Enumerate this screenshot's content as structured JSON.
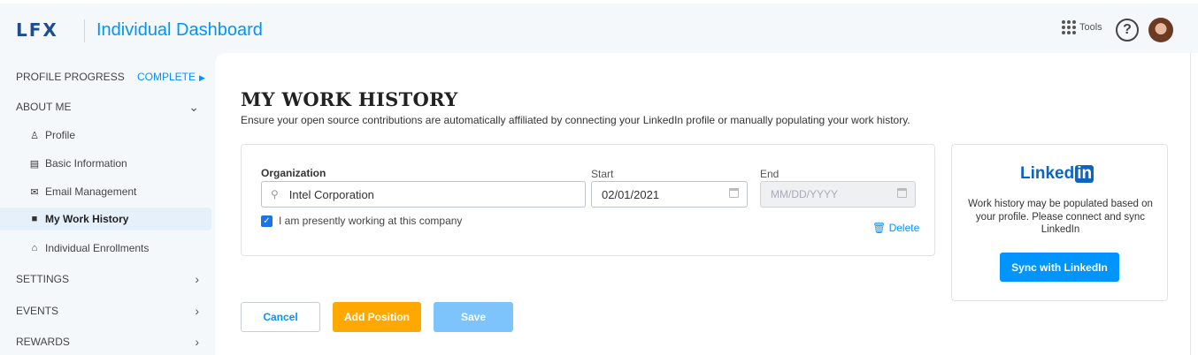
{
  "header": {
    "logo": "LFX",
    "title": "Individual Dashboard",
    "tools_label": "Tools",
    "help_icon": "?"
  },
  "sidebar": {
    "profile_progress": {
      "label": "PROFILE PROGRESS",
      "status": "Complete"
    },
    "about_me": "ABOUT ME",
    "items": [
      {
        "label": "Profile",
        "icon": "person-icon"
      },
      {
        "label": "Basic Information",
        "icon": "id-card-icon"
      },
      {
        "label": "Email Management",
        "icon": "envelope-icon"
      },
      {
        "label": "My Work History",
        "icon": "briefcase-icon"
      },
      {
        "label": "Individual Enrollments",
        "icon": "enroll-icon"
      }
    ],
    "sections": [
      "SETTINGS",
      "EVENTS",
      "REWARDS"
    ]
  },
  "main": {
    "title": "MY WORK HISTORY",
    "subtitle": "Ensure your open source contributions are automatically affiliated by connecting your LinkedIn profile or manually populating your work history.",
    "position": {
      "org_label": "Organization",
      "org_value": "Intel Corporation",
      "start_label": "Start",
      "start_value": "02/01/2021",
      "end_label": "End",
      "end_placeholder": "MM/DD/YYYY",
      "present_label": "I am presently working at this company",
      "present_checked": true,
      "delete_label": "Delete"
    },
    "buttons": {
      "cancel": "Cancel",
      "add": "Add Position",
      "save": "Save"
    }
  },
  "linkedin": {
    "logo_text": "Linked",
    "logo_in": "in",
    "description": "Work history may be populated based on your profile. Please connect and sync LinkedIn",
    "sync_button": "Sync with LinkedIn"
  },
  "colors": {
    "accent": "#0094ff",
    "add_button": "#ffa800",
    "save_button": "#7cc4fb",
    "linkedin": "#0a66c2"
  }
}
